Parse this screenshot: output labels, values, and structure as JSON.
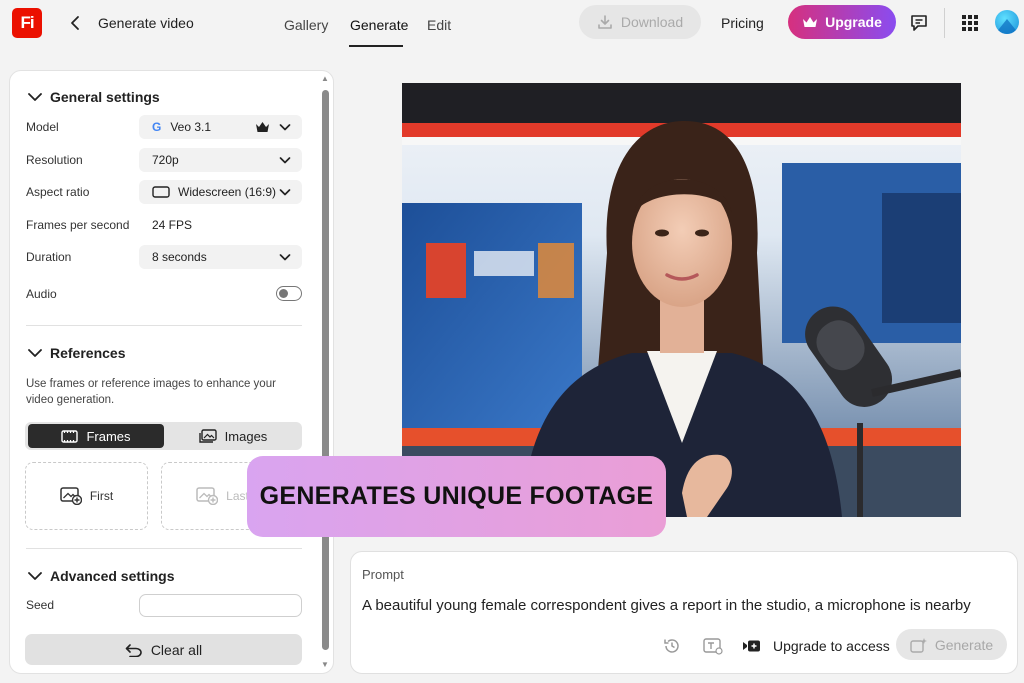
{
  "header": {
    "logo_text": "Fi",
    "title": "Generate video",
    "tabs": [
      {
        "label": "Gallery"
      },
      {
        "label": "Generate",
        "active": true
      },
      {
        "label": "Edit"
      }
    ],
    "download_label": "Download",
    "pricing_label": "Pricing",
    "upgrade_label": "Upgrade"
  },
  "colors": {
    "brand_red": "#eb1000",
    "upgrade_gradient_start": "#d6307e",
    "upgrade_gradient_end": "#8a4cf0",
    "caption_gradient_start": "#d9a4f0",
    "caption_gradient_end": "#ea9ed6"
  },
  "general": {
    "title": "General settings",
    "model_label": "Model",
    "model_value": "Veo 3.1",
    "model_brand_letter": "G",
    "resolution_label": "Resolution",
    "resolution_value": "720p",
    "aspect_label": "Aspect ratio",
    "aspect_value": "Widescreen (16:9)",
    "fps_label": "Frames per second",
    "fps_value": "24 FPS",
    "duration_label": "Duration",
    "duration_value": "8 seconds",
    "audio_label": "Audio",
    "audio_on": false
  },
  "references": {
    "title": "References",
    "description": "Use frames or reference images to enhance your video generation.",
    "seg_frames": "Frames",
    "seg_images": "Images",
    "first_label": "First",
    "last_label": "Last"
  },
  "advanced": {
    "title": "Advanced settings",
    "seed_label": "Seed",
    "seed_value": ""
  },
  "clear_all_label": "Clear all",
  "prompt": {
    "label": "Prompt",
    "text": "A beautiful young female correspondent gives a report in the studio, a microphone is nearby",
    "upgrade_access_label": "Upgrade to access",
    "generate_label": "Generate"
  },
  "caption": "GENERATES UNIQUE FOOTAGE",
  "icons": [
    "back-chevron-icon",
    "download-icon",
    "crown-icon",
    "feedback-icon",
    "apps-grid-icon",
    "chevron-down-icon",
    "widescreen-icon",
    "film-icon",
    "image-icon",
    "add-image-icon",
    "undo-icon",
    "history-icon",
    "text-style-icon",
    "video-camera-icon",
    "generate-sparkle-icon"
  ]
}
